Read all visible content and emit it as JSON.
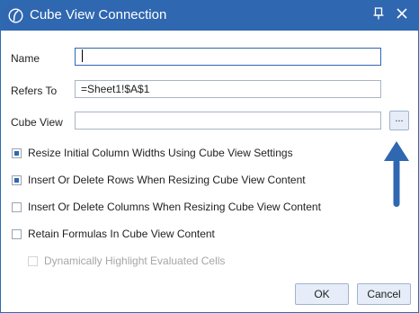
{
  "window": {
    "title": "Cube View Connection"
  },
  "form": {
    "name_label": "Name",
    "name_value": "",
    "refers_to_label": "Refers To",
    "refers_to_value": "=Sheet1!$A$1",
    "cube_view_label": "Cube View",
    "cube_view_value": "",
    "browse_button_label": "..."
  },
  "options": [
    {
      "label": "Resize Initial Column Widths Using Cube View Settings",
      "checked": true,
      "enabled": true
    },
    {
      "label": "Insert Or Delete Rows When Resizing Cube View Content",
      "checked": true,
      "enabled": true
    },
    {
      "label": "Insert Or Delete Columns When Resizing Cube View Content",
      "checked": false,
      "enabled": true
    },
    {
      "label": "Retain Formulas In Cube View Content",
      "checked": false,
      "enabled": true
    },
    {
      "label": "Dynamically Highlight Evaluated Cells",
      "checked": false,
      "enabled": false
    }
  ],
  "buttons": {
    "ok_label": "OK",
    "cancel_label": "Cancel"
  },
  "colors": {
    "titlebar": "#2f67b0",
    "accent_arrow": "#2f67b0",
    "button_bg": "#e6edf8"
  },
  "icons": {
    "app_logo": "onestream-logo-icon",
    "pin": "pin-icon",
    "close": "close-icon",
    "pointer": "arrow-up-icon"
  }
}
